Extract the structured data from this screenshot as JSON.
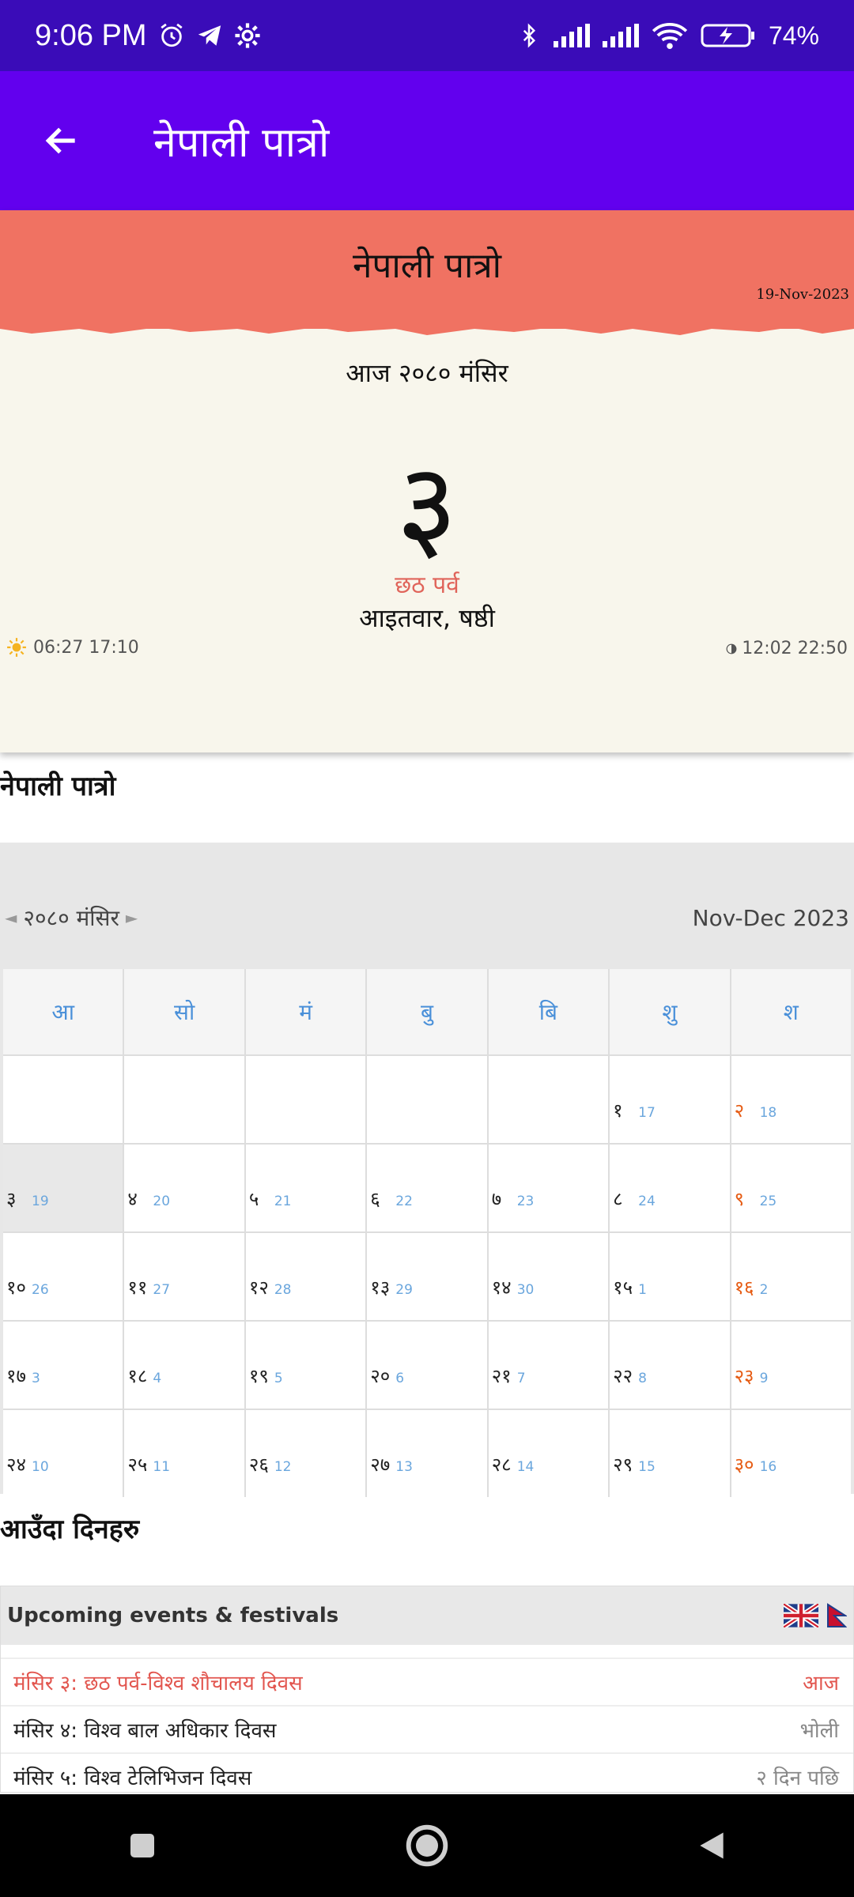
{
  "status": {
    "time": "9:06 PM",
    "battery": "74%"
  },
  "appbar": {
    "title": "नेपाली पात्रो"
  },
  "today_card": {
    "header_title": "नेपाली पात्रो",
    "date": "19-Nov-2023",
    "label": "आज २०८० मंसिर",
    "day": "३",
    "event": "छठ पर्व",
    "weekday": "आइतवार, षष्ठी",
    "sun": "06:27 17:10",
    "moon": "12:02 22:50"
  },
  "calendar_section": {
    "title": "नेपाली पात्रो"
  },
  "calendar": {
    "month_label": "२०८० मंसिर",
    "english_range": "Nov-Dec 2023",
    "weekdays": [
      "आ",
      "सो",
      "मं",
      "बु",
      "बि",
      "शु",
      "श"
    ],
    "weeks": [
      [
        {
          "np": "",
          "en": ""
        },
        {
          "np": "",
          "en": ""
        },
        {
          "np": "",
          "en": ""
        },
        {
          "np": "",
          "en": ""
        },
        {
          "np": "",
          "en": ""
        },
        {
          "np": "१",
          "en": "17"
        },
        {
          "np": "२",
          "en": "18"
        }
      ],
      [
        {
          "np": "३",
          "en": "19"
        },
        {
          "np": "४",
          "en": "20"
        },
        {
          "np": "५",
          "en": "21"
        },
        {
          "np": "६",
          "en": "22"
        },
        {
          "np": "७",
          "en": "23"
        },
        {
          "np": "८",
          "en": "24"
        },
        {
          "np": "९",
          "en": "25"
        }
      ],
      [
        {
          "np": "१०",
          "en": "26"
        },
        {
          "np": "११",
          "en": "27"
        },
        {
          "np": "१२",
          "en": "28"
        },
        {
          "np": "१३",
          "en": "29"
        },
        {
          "np": "१४",
          "en": "30"
        },
        {
          "np": "१५",
          "en": "1"
        },
        {
          "np": "१६",
          "en": "2"
        }
      ],
      [
        {
          "np": "१७",
          "en": "3"
        },
        {
          "np": "१८",
          "en": "4"
        },
        {
          "np": "१९",
          "en": "5"
        },
        {
          "np": "२०",
          "en": "6"
        },
        {
          "np": "२१",
          "en": "7"
        },
        {
          "np": "२२",
          "en": "8"
        },
        {
          "np": "२३",
          "en": "9"
        }
      ],
      [
        {
          "np": "२४",
          "en": "10"
        },
        {
          "np": "२५",
          "en": "11"
        },
        {
          "np": "२६",
          "en": "12"
        },
        {
          "np": "२७",
          "en": "13"
        },
        {
          "np": "२८",
          "en": "14"
        },
        {
          "np": "२९",
          "en": "15"
        },
        {
          "np": "३०",
          "en": "16"
        }
      ]
    ],
    "today_np": "३"
  },
  "upcoming_section": {
    "title": "आउँदा दिनहरु"
  },
  "upcoming": {
    "header": "Upcoming events & festivals",
    "items": [
      {
        "label": "मंसिर ३: छठ पर्व-विश्व शौचालय दिवस",
        "when": "आज",
        "highlight": true
      },
      {
        "label": "मंसिर ४: विश्व बाल अधिकार दिवस",
        "when": "भोली",
        "highlight": false
      },
      {
        "label": "मंसिर ५: विश्व टेलिभिजन दिवस",
        "when": "२ दिन पछि",
        "highlight": false
      }
    ]
  },
  "colors": {
    "status_bar": "#3a0cb8",
    "app_bar": "#6200ee",
    "card_header": "#f07262",
    "saturday": "#e65c14",
    "english_date": "#6aa6dd"
  }
}
